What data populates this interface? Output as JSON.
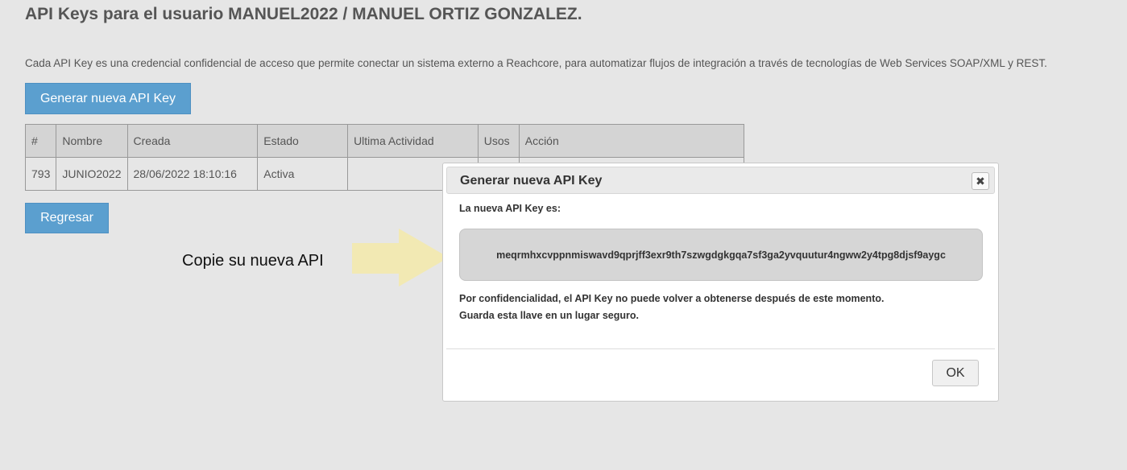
{
  "page": {
    "title": "API Keys para el usuario MANUEL2022 / MANUEL ORTIZ GONZALEZ.",
    "intro": "Cada API Key es una credencial confidencial de acceso que permite conectar un sistema externo a Reachcore, para automatizar flujos de integración a través de tecnologías de Web Services SOAP/XML y REST.",
    "generate_button": "Generar nueva API Key",
    "back_button": "Regresar"
  },
  "table": {
    "headers": [
      "#",
      "Nombre",
      "Creada",
      "Estado",
      "Ultima Actividad",
      "Usos",
      "Acción"
    ],
    "rows": [
      [
        "793",
        "JUNIO2022",
        "28/06/2022 18:10:16",
        "Activa",
        "",
        "",
        ""
      ]
    ]
  },
  "annotation": {
    "text": "Copie su nueva API",
    "arrow_color": "#f2e9b3"
  },
  "modal": {
    "title": "Generar nueva API Key",
    "close_icon": "close-icon",
    "label": "La nueva API Key es:",
    "api_key": "meqrmhxcvppnmiswavd9qprjff3exr9th7szwgdgkgqa7sf3ga2yvquutur4ngww2y4tpg8djsf9aygc",
    "note_line1": "Por confidencialidad, el API Key no puede volver a obtenerse después de este momento.",
    "note_line2": "Guarda esta llave en un lugar seguro.",
    "ok_button": "OK"
  },
  "colors": {
    "primary_button": "#5b9fcf",
    "background": "#e6e6e6"
  }
}
